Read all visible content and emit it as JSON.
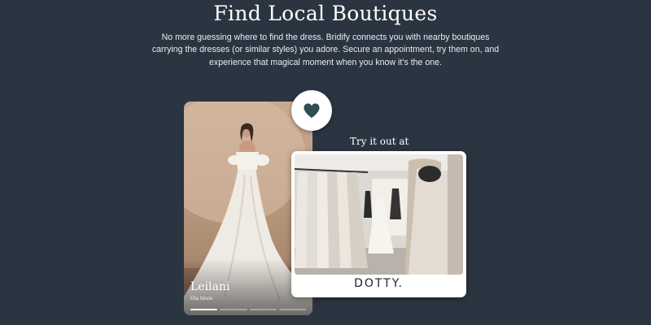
{
  "section": {
    "title": "Find Local Boutiques",
    "description": "No more guessing where to find the dress. Bridify connects you with nearby boutiques carrying the dresses (or similar styles) you adore. Secure an appointment, try them on, and experience that magical moment when you know it’s the one."
  },
  "dress_card": {
    "name": "Leilani",
    "designer": "Ella Novia",
    "slides_total": 4,
    "slide_active": 1,
    "favorite_icon": "heart-icon"
  },
  "try_on": {
    "label": "Try it out at",
    "boutique_logo": "DOTTY."
  },
  "colors": {
    "background": "#2b3541",
    "heart": "#2f4d52",
    "card_bg": "#ffffff"
  }
}
